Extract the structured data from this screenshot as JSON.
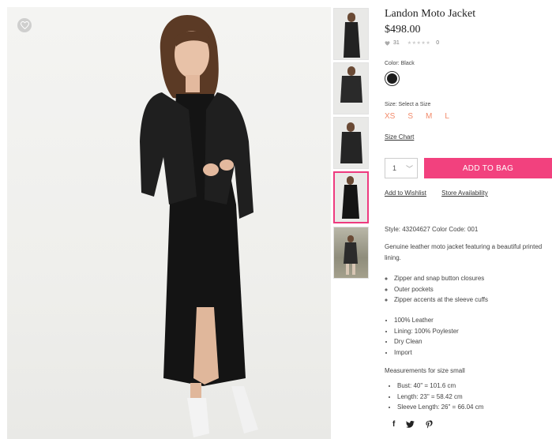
{
  "product": {
    "title": "Landon Moto Jacket",
    "price": "$498.00",
    "favorites_count": "31",
    "rating_stars": "★★★★★",
    "review_count": "0"
  },
  "color": {
    "label": "Color: Black",
    "selected_hex": "#1d1d1d"
  },
  "size": {
    "label": "Size: Select a Size",
    "options": [
      "XS",
      "S",
      "M",
      "L"
    ],
    "option_color": "#f28a6a"
  },
  "size_chart_label": "Size Chart",
  "quantity": {
    "value": "1",
    "chevron": "﹀"
  },
  "add_to_bag": {
    "label": "ADD TO BAG",
    "color": "#f2417e"
  },
  "links": {
    "wishlist": "Add to Wishlist",
    "store": "Store Availability"
  },
  "style_code": "Style: 43204627 Color Code: 001",
  "description": "Genuine leather moto jacket featuring a beautiful printed lining.",
  "features": [
    "Zipper and snap button closures",
    "Outer pockets",
    "Zipper accents at the sleeve cuffs"
  ],
  "materials": [
    "100% Leather",
    "Lining: 100% Poylester",
    "Dry Clean",
    "Import"
  ],
  "measurements": {
    "title": "Measurements for size small",
    "items": [
      "Bust: 40\" = 101.6 cm",
      "Length: 23\" = 58.42 cm",
      "Sleeve Length: 26\" = 66.04 cm"
    ]
  },
  "social": {
    "facebook": "f",
    "twitter": "🐦",
    "pinterest": "℘"
  },
  "icons": {
    "heart": "heart-icon",
    "chevron": "chevron-down-icon",
    "facebook": "facebook-icon",
    "twitter": "twitter-icon",
    "pinterest": "pinterest-icon"
  },
  "thumbnails": {
    "active_index": 3,
    "active_border": "#ee3a7f"
  }
}
